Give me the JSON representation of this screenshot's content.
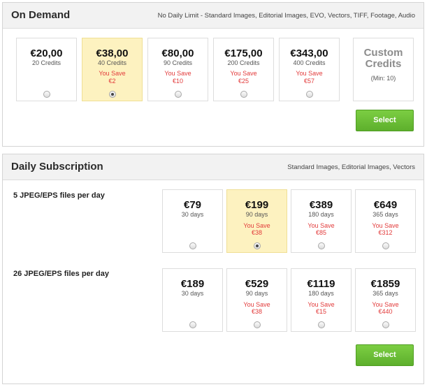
{
  "on_demand": {
    "title": "On Demand",
    "note": "No Daily Limit - Standard Images, Editorial Images, EVO, Vectors, TIFF, Footage, Audio",
    "plans": [
      {
        "price": "€20,00",
        "credits": "20 Credits",
        "save_label": "",
        "save_amount": "",
        "selected": false
      },
      {
        "price": "€38,00",
        "credits": "40 Credits",
        "save_label": "You Save",
        "save_amount": "€2",
        "selected": true
      },
      {
        "price": "€80,00",
        "credits": "90 Credits",
        "save_label": "You Save",
        "save_amount": "€10",
        "selected": false
      },
      {
        "price": "€175,00",
        "credits": "200 Credits",
        "save_label": "You Save",
        "save_amount": "€25",
        "selected": false
      },
      {
        "price": "€343,00",
        "credits": "400 Credits",
        "save_label": "You Save",
        "save_amount": "€57",
        "selected": false
      }
    ],
    "custom": {
      "line1": "Custom",
      "line2": "Credits",
      "min": "(Min: 10)"
    },
    "select_label": "Select"
  },
  "daily": {
    "title": "Daily Subscription",
    "note": "Standard Images, Editorial Images, Vectors",
    "rows": [
      {
        "label": "5 JPEG/EPS files per day",
        "plans": [
          {
            "price": "€79",
            "days": "30 days",
            "save_label": "",
            "save_amount": "",
            "selected": false
          },
          {
            "price": "€199",
            "days": "90 days",
            "save_label": "You Save",
            "save_amount": "€38",
            "selected": true
          },
          {
            "price": "€389",
            "days": "180 days",
            "save_label": "You Save",
            "save_amount": "€85",
            "selected": false
          },
          {
            "price": "€649",
            "days": "365 days",
            "save_label": "You Save",
            "save_amount": "€312",
            "selected": false
          }
        ]
      },
      {
        "label": "26 JPEG/EPS files per day",
        "plans": [
          {
            "price": "€189",
            "days": "30 days",
            "save_label": "",
            "save_amount": "",
            "selected": false
          },
          {
            "price": "€529",
            "days": "90 days",
            "save_label": "You Save",
            "save_amount": "€38",
            "selected": false
          },
          {
            "price": "€1119",
            "days": "180 days",
            "save_label": "You Save",
            "save_amount": "€15",
            "selected": false
          },
          {
            "price": "€1859",
            "days": "365 days",
            "save_label": "You Save",
            "save_amount": "€440",
            "selected": false
          }
        ]
      }
    ],
    "select_label": "Select"
  },
  "colors": {
    "accent_green": "#6abf36",
    "selected_bg": "#fdf2c0",
    "save_red": "#e23a3a"
  }
}
